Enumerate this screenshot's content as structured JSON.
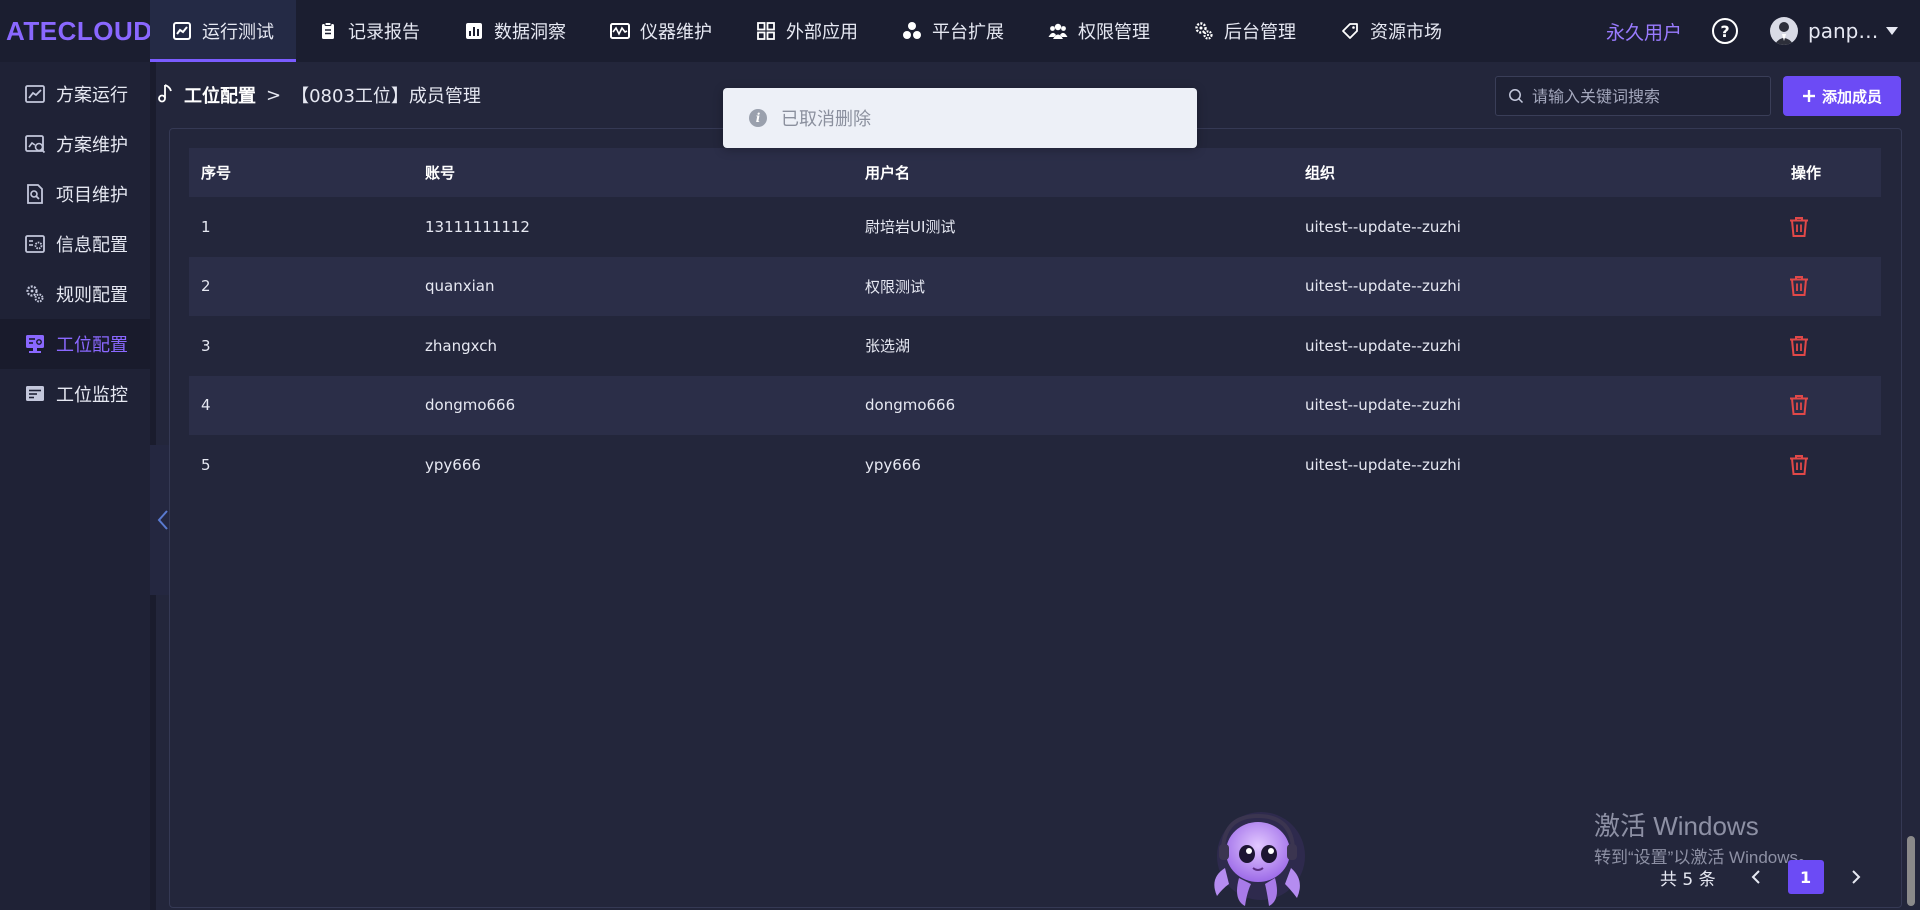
{
  "app": {
    "logo": "ATECLOUD"
  },
  "nav": {
    "items": [
      {
        "label": "运行测试",
        "icon": "chart-line-icon"
      },
      {
        "label": "记录报告",
        "icon": "clipboard-icon"
      },
      {
        "label": "数据洞察",
        "icon": "bar-chart-icon"
      },
      {
        "label": "仪器维护",
        "icon": "oscilloscope-icon"
      },
      {
        "label": "外部应用",
        "icon": "grid-icon"
      },
      {
        "label": "平台扩展",
        "icon": "cluster-icon"
      },
      {
        "label": "权限管理",
        "icon": "users-icon"
      },
      {
        "label": "后台管理",
        "icon": "gears-icon"
      },
      {
        "label": "资源市场",
        "icon": "tag-icon"
      }
    ]
  },
  "header": {
    "vip_label": "永久用户",
    "help": "?",
    "username": "panp…"
  },
  "sidebar": {
    "items": [
      {
        "label": "方案运行"
      },
      {
        "label": "方案维护"
      },
      {
        "label": "项目维护"
      },
      {
        "label": "信息配置"
      },
      {
        "label": "规则配置"
      },
      {
        "label": "工位配置"
      },
      {
        "label": "工位监控"
      }
    ]
  },
  "breadcrumb": {
    "root": "工位配置",
    "separator": ">",
    "current": "【0803工位】成员管理"
  },
  "toolbar": {
    "search_placeholder": "请输入关键词搜索",
    "add_label": "添加成员"
  },
  "toast": {
    "message": "已取消删除"
  },
  "table": {
    "headers": {
      "index": "序号",
      "account": "账号",
      "username": "用户名",
      "org": "组织",
      "ops": "操作"
    },
    "rows": [
      {
        "index": "1",
        "account": "13111111112",
        "username": "尉培岩UI测试",
        "org": "uitest--update--zuzhi"
      },
      {
        "index": "2",
        "account": "quanxian",
        "username": "权限测试",
        "org": "uitest--update--zuzhi"
      },
      {
        "index": "3",
        "account": "zhangxch",
        "username": "张选湖",
        "org": "uitest--update--zuzhi"
      },
      {
        "index": "4",
        "account": "dongmo666",
        "username": "dongmo666",
        "org": "uitest--update--zuzhi"
      },
      {
        "index": "5",
        "account": "ypy666",
        "username": "ypy666",
        "org": "uitest--update--zuzhi"
      }
    ]
  },
  "pagination": {
    "total": "共 5 条",
    "current": "1"
  },
  "watermark": {
    "title": "激活 Windows",
    "subtitle": "转到“设置”以激活 Windows。"
  },
  "colors": {
    "accent": "#6c4bf5",
    "logo": "#8a68ff",
    "danger": "#e04848",
    "bg": "#23263b"
  }
}
